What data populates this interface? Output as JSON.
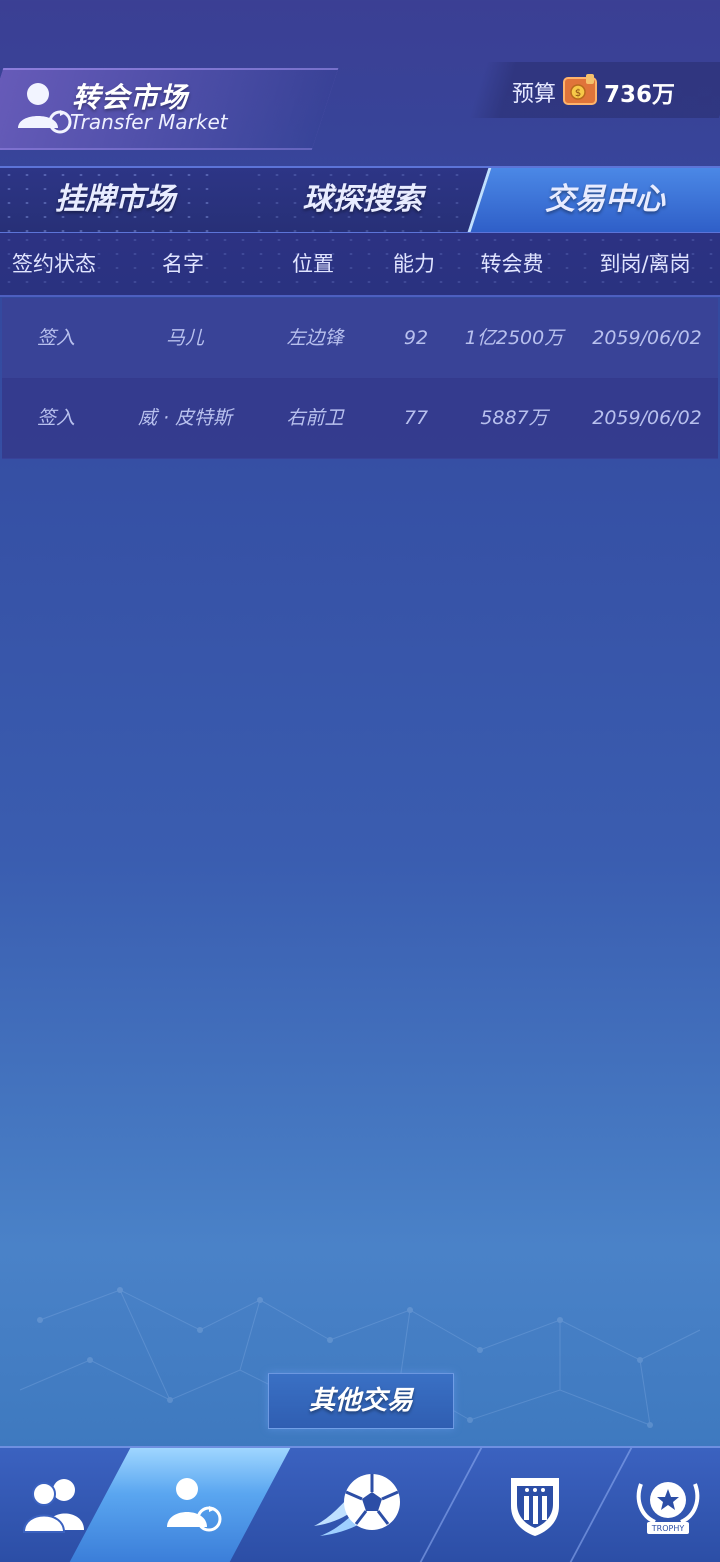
{
  "header": {
    "title_cn": "转会市场",
    "title_en": "Transfer Market",
    "budget_label": "预算",
    "budget_value": "736万",
    "icons": [
      "transfer-icon",
      "wallet-icon"
    ]
  },
  "tabs": [
    {
      "label": "挂牌市场",
      "active": false
    },
    {
      "label": "球探搜索",
      "active": false
    },
    {
      "label": "交易中心",
      "active": true
    }
  ],
  "table": {
    "columns": [
      "签约状态",
      "名字",
      "位置",
      "能力",
      "转会费",
      "到岗/离岗"
    ],
    "rows": [
      [
        "签入",
        "马儿",
        "左边锋",
        "92",
        "1亿2500万",
        "2059/06/02"
      ],
      [
        "签入",
        "威 · 皮特斯",
        "右前卫",
        "77",
        "5887万",
        "2059/06/02"
      ]
    ]
  },
  "other_trade_label": "其他交易",
  "bottom_nav": {
    "items": [
      "squad-icon",
      "transfer-icon",
      "match-ball-icon",
      "club-crest-icon",
      "trophy-icon"
    ],
    "active_index": 1,
    "trophy_text": "TROPHY"
  },
  "colors": {
    "accent": "#4b88e6",
    "row_text": "#b8c0ee",
    "header_bg": "#2c3283"
  }
}
